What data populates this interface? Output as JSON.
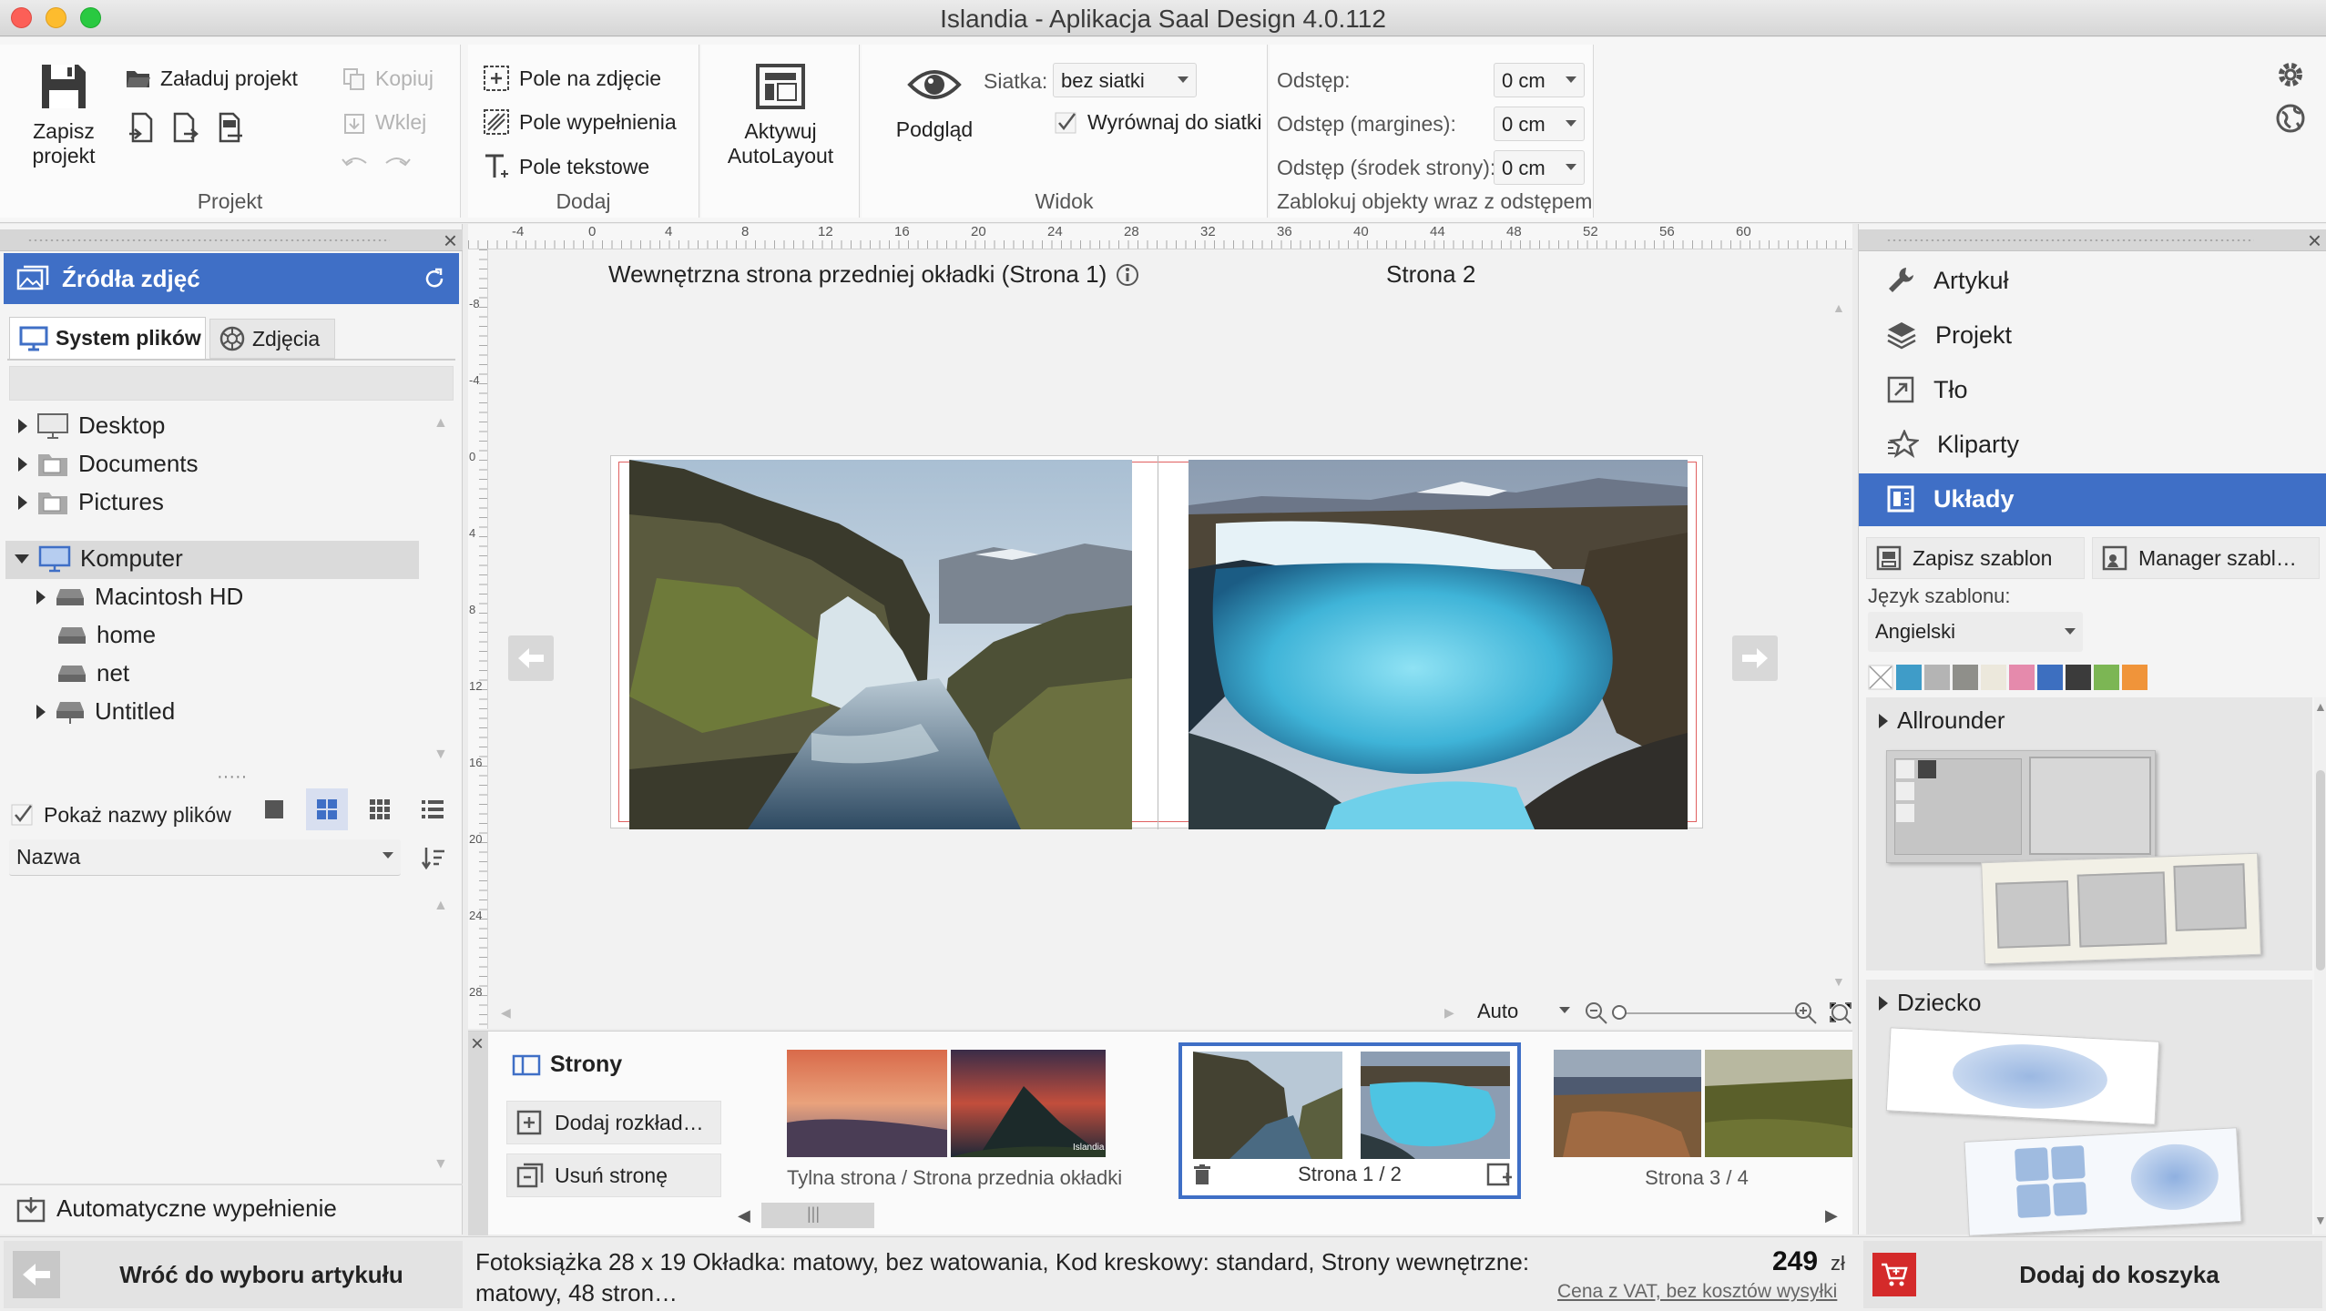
{
  "window": {
    "title": "Islandia - Aplikacja Saal Design 4.0.112"
  },
  "ribbon": {
    "projekt": {
      "label": "Projekt",
      "save": "Zapisz projekt",
      "load": "Załaduj projekt",
      "copy": "Kopiuj",
      "paste": "Wklej"
    },
    "dodaj": {
      "label": "Dodaj",
      "photo_field": "Pole na zdjęcie",
      "fill_field": "Pole wypełnienia",
      "text_field": "Pole tekstowe"
    },
    "autolayout": {
      "label": "Aktywuj AutoLayout"
    },
    "widok": {
      "label": "Widok",
      "preview": "Podgląd",
      "grid_label": "Siatka:",
      "grid_value": "bez siatki",
      "align": "Wyrównaj do siatki"
    },
    "spacing": {
      "label": "Zablokuj objekty wraz z odstępem",
      "gap": "Odstęp:",
      "gap_value": "0 cm",
      "margins": "Odstęp (margines):",
      "margins_value": "0 cm",
      "center": "Odstęp (środek strony):",
      "center_value": "0 cm"
    }
  },
  "left": {
    "header": "Źródła zdjęć",
    "tabs": [
      "System plików",
      "Zdjęcia"
    ],
    "tree": {
      "desktop": "Desktop",
      "documents": "Documents",
      "pictures": "Pictures",
      "computer": "Komputer",
      "mac": "Macintosh HD",
      "home": "home",
      "net": "net",
      "untitled": "Untitled"
    },
    "show_names": "Pokaż nazwy plików",
    "sort": "Nazwa",
    "autofill": "Automatyczne wypełnienie"
  },
  "canvas": {
    "page_left": "Wewnętrzna strona przedniej okładki (Strona 1)",
    "page_right": "Strona 2",
    "zoom": "Auto",
    "ruler_top": [
      "-4",
      "0",
      "4",
      "8",
      "12",
      "16",
      "20",
      "24",
      "28",
      "32",
      "36",
      "40",
      "44",
      "48",
      "52",
      "56",
      "60"
    ],
    "ruler_left": [
      "-8",
      "-4",
      "0",
      "4",
      "8",
      "12",
      "16",
      "20",
      "24",
      "28"
    ]
  },
  "pages": {
    "title": "Strony",
    "add": "Dodaj rozkład…",
    "remove": "Usuń stronę",
    "thumbs": [
      "Tylna strona / Strona przednia okładki",
      "Strona 1 / 2",
      "Strona 3 / 4"
    ],
    "islandia_mark": "Islandia"
  },
  "right": {
    "menu": [
      "Artykuł",
      "Projekt",
      "Tło",
      "Kliparty",
      "Układy"
    ],
    "save_tpl": "Zapisz szablon",
    "manager": "Manager szabl…",
    "lang_label": "Język szablonu:",
    "lang_value": "Angielski",
    "swatches": [
      "#3f9cc8",
      "#b4b4b4",
      "#8f8f8a",
      "#ece8dc",
      "#e58aac",
      "#3d6fc0",
      "#3b3b3b",
      "#7cb654",
      "#f0943a"
    ],
    "sections": [
      "Allrounder",
      "Dziecko"
    ]
  },
  "status": {
    "back": "Wróć do wyboru artykułu",
    "desc": "Fotoksiążka 28 x 19 Okładka: matowy, bez watowania, Kod kreskowy: standard, Strony wewnętrzne: matowy, 48 stron…",
    "price": "249",
    "currency": "zł",
    "vat": "Cena z VAT, bez kosztów wysyłki",
    "cart": "Dodaj do koszyka"
  }
}
